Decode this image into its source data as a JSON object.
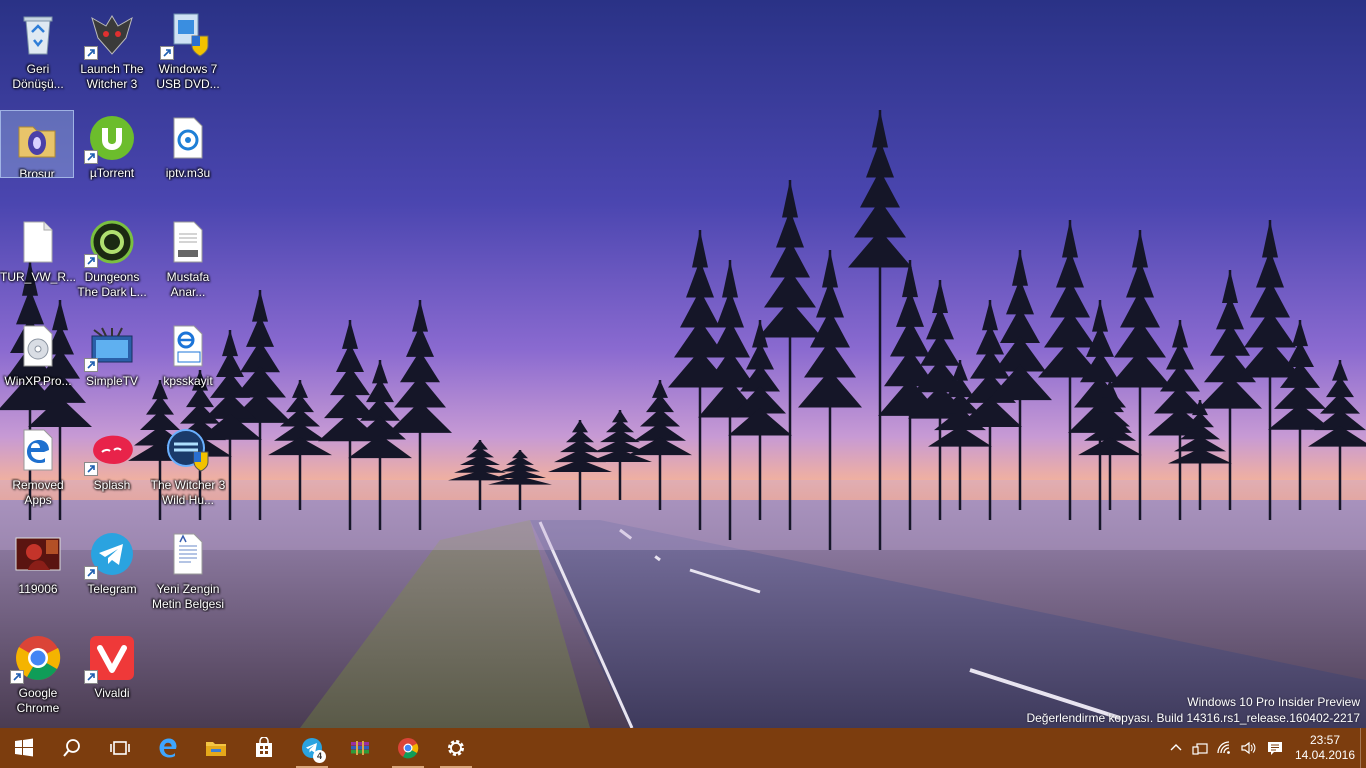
{
  "desktop": {
    "icons": [
      {
        "label": "Geri Dönüşü...",
        "icon": "recycle-bin-icon"
      },
      {
        "label": "Launch The Witcher 3",
        "icon": "witcher-icon"
      },
      {
        "label": "Windows 7 USB DVD...",
        "icon": "windows-usb-tool-icon"
      },
      {
        "label": "Broşur",
        "icon": "folder-icon"
      },
      {
        "label": "µTorrent",
        "icon": "utorrent-icon"
      },
      {
        "label": "iptv.m3u",
        "icon": "media-file-icon"
      },
      {
        "label": "TUR_VW_R...",
        "icon": "blank-file-icon"
      },
      {
        "label": "Dungeons The Dark L...",
        "icon": "dungeons-game-icon"
      },
      {
        "label": "Mustafa Anar...",
        "icon": "docx-file-icon"
      },
      {
        "label": "WinXP.Pro...",
        "icon": "disc-image-icon"
      },
      {
        "label": "SimpleTV",
        "icon": "simpletv-icon"
      },
      {
        "label": "kpsskayit",
        "icon": "pdf-file-icon"
      },
      {
        "label": "Removed Apps",
        "icon": "edge-icon"
      },
      {
        "label": "Splash",
        "icon": "splash-icon"
      },
      {
        "label": "The Witcher 3 Wild Hu...",
        "icon": "trainer-icon"
      },
      {
        "label": "119006",
        "icon": "image-thumbnail-icon"
      },
      {
        "label": "Telegram",
        "icon": "telegram-icon"
      },
      {
        "label": "Yeni Zengin Metin Belgesi",
        "icon": "rtf-document-icon"
      },
      {
        "label": "Google Chrome",
        "icon": "chrome-icon"
      },
      {
        "label": "Vivaldi",
        "icon": "vivaldi-icon"
      }
    ]
  },
  "watermark": {
    "line1": "Windows 10 Pro Insider Preview",
    "line2": "Değerlendirme kopyası. Build 14316.rs1_release.160402-2217"
  },
  "taskbar": {
    "color": "#7c3d0e",
    "telegram_badge": "4",
    "clock": {
      "time": "23:57",
      "date": "14.04.2016"
    }
  }
}
